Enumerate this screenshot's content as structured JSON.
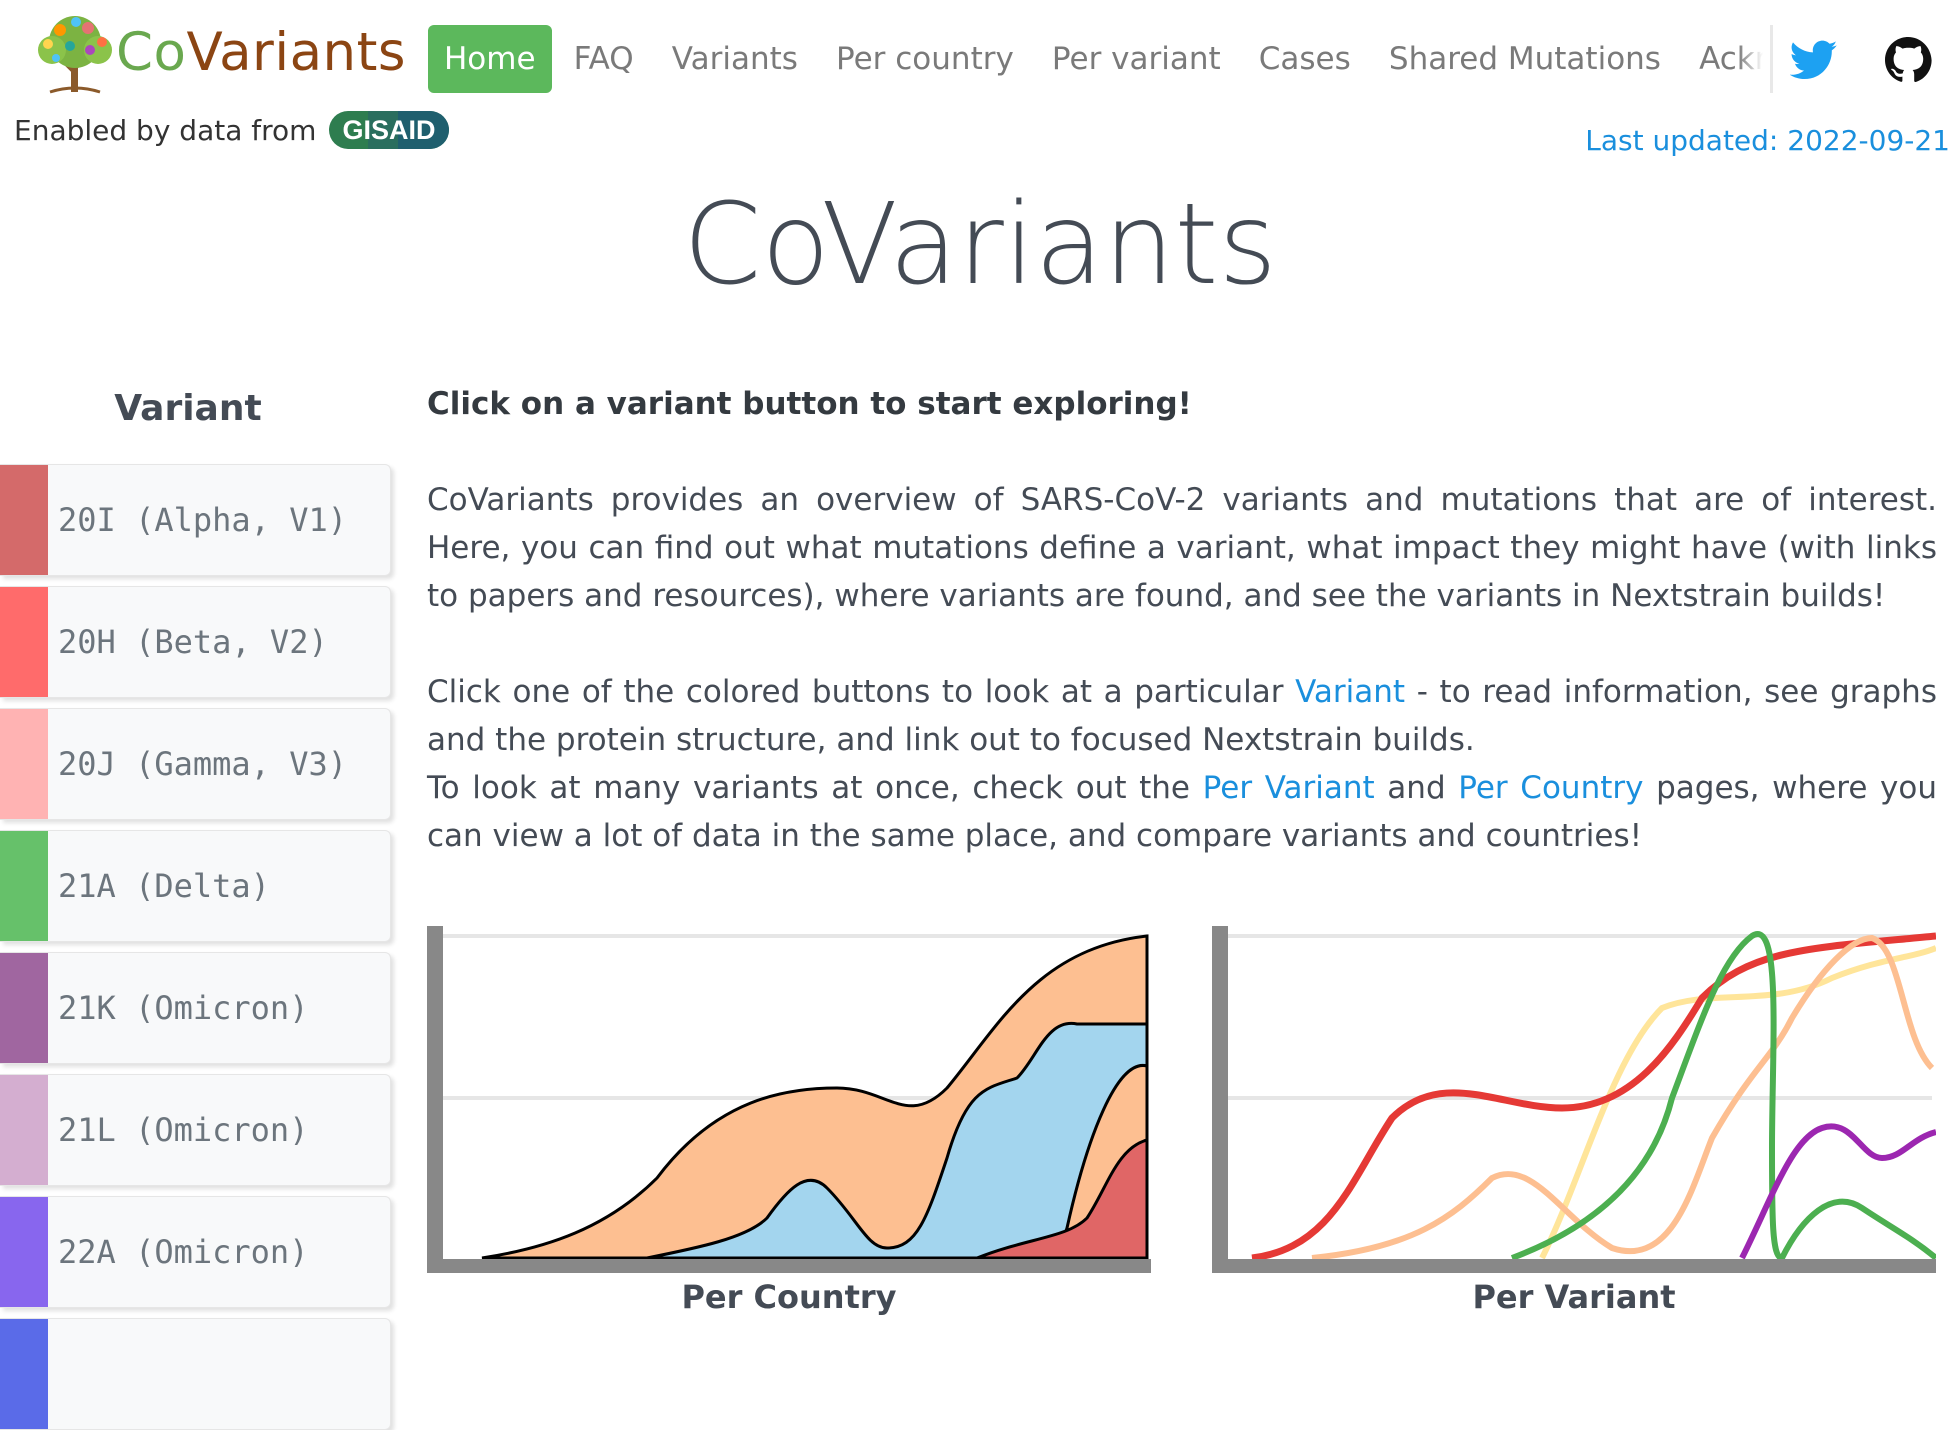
{
  "brand": {
    "part1": "Co",
    "part2": "Variants",
    "logo_icon": "tree-logo-icon"
  },
  "nav": {
    "items": [
      "Home",
      "FAQ",
      "Variants",
      "Per country",
      "Per variant",
      "Cases",
      "Shared Mutations",
      "Acknowledgements"
    ],
    "active": "Home",
    "active_color": "#5cb85c"
  },
  "social": {
    "twitter_icon": "twitter-icon",
    "github_icon": "github-icon"
  },
  "enabled_by": {
    "text": "Enabled by data from",
    "badge": "GISAID"
  },
  "last_updated": {
    "label": "Last updated:",
    "date": "2022-09-21"
  },
  "page_title": "CoVariants",
  "sidebar": {
    "heading": "Variant",
    "variants": [
      {
        "label": "20I (Alpha, V1)",
        "color": "#d46a6a"
      },
      {
        "label": "20H (Beta, V2)",
        "color": "#ff6b6b"
      },
      {
        "label": "20J (Gamma, V3)",
        "color": "#ffb3b3"
      },
      {
        "label": "21A (Delta)",
        "color": "#66c16a"
      },
      {
        "label": "21K (Omicron)",
        "color": "#a066a0"
      },
      {
        "label": "21L (Omicron)",
        "color": "#d4aed0"
      },
      {
        "label": "22A (Omicron)",
        "color": "#8866ee"
      }
    ],
    "next_color": "#5a6be8"
  },
  "intro": {
    "headline": "Click on a variant button to start exploring!",
    "para1": "CoVariants provides an overview of SARS-CoV-2 variants and mutations that are of interest. Here, you can find out what mutations define a variant, what impact they might have (with links to papers and resources), where variants are found, and see the variants in Nextstrain builds!",
    "para2_before": "Click one of the colored buttons to look at a particular",
    "para2_link": "Variant",
    "para2_after": "- to read information, see graphs and the protein structure, and link out to focused Nextstrain builds.",
    "para3_before": "To look at many variants at once, check out the",
    "para3_link1": "Per Variant",
    "para3_mid": "and",
    "para3_link2": "Per Country",
    "para3_after": "pages, where you can view a lot of data in the same place, and compare variants and countries!"
  },
  "charts": {
    "left_caption": "Per Country",
    "right_caption": "Per Variant"
  },
  "colors": {
    "link": "#1a8fdd",
    "axis": "#888888",
    "orange": "#fdbf91",
    "blue": "#a3d5ee",
    "red": "#e06666"
  }
}
